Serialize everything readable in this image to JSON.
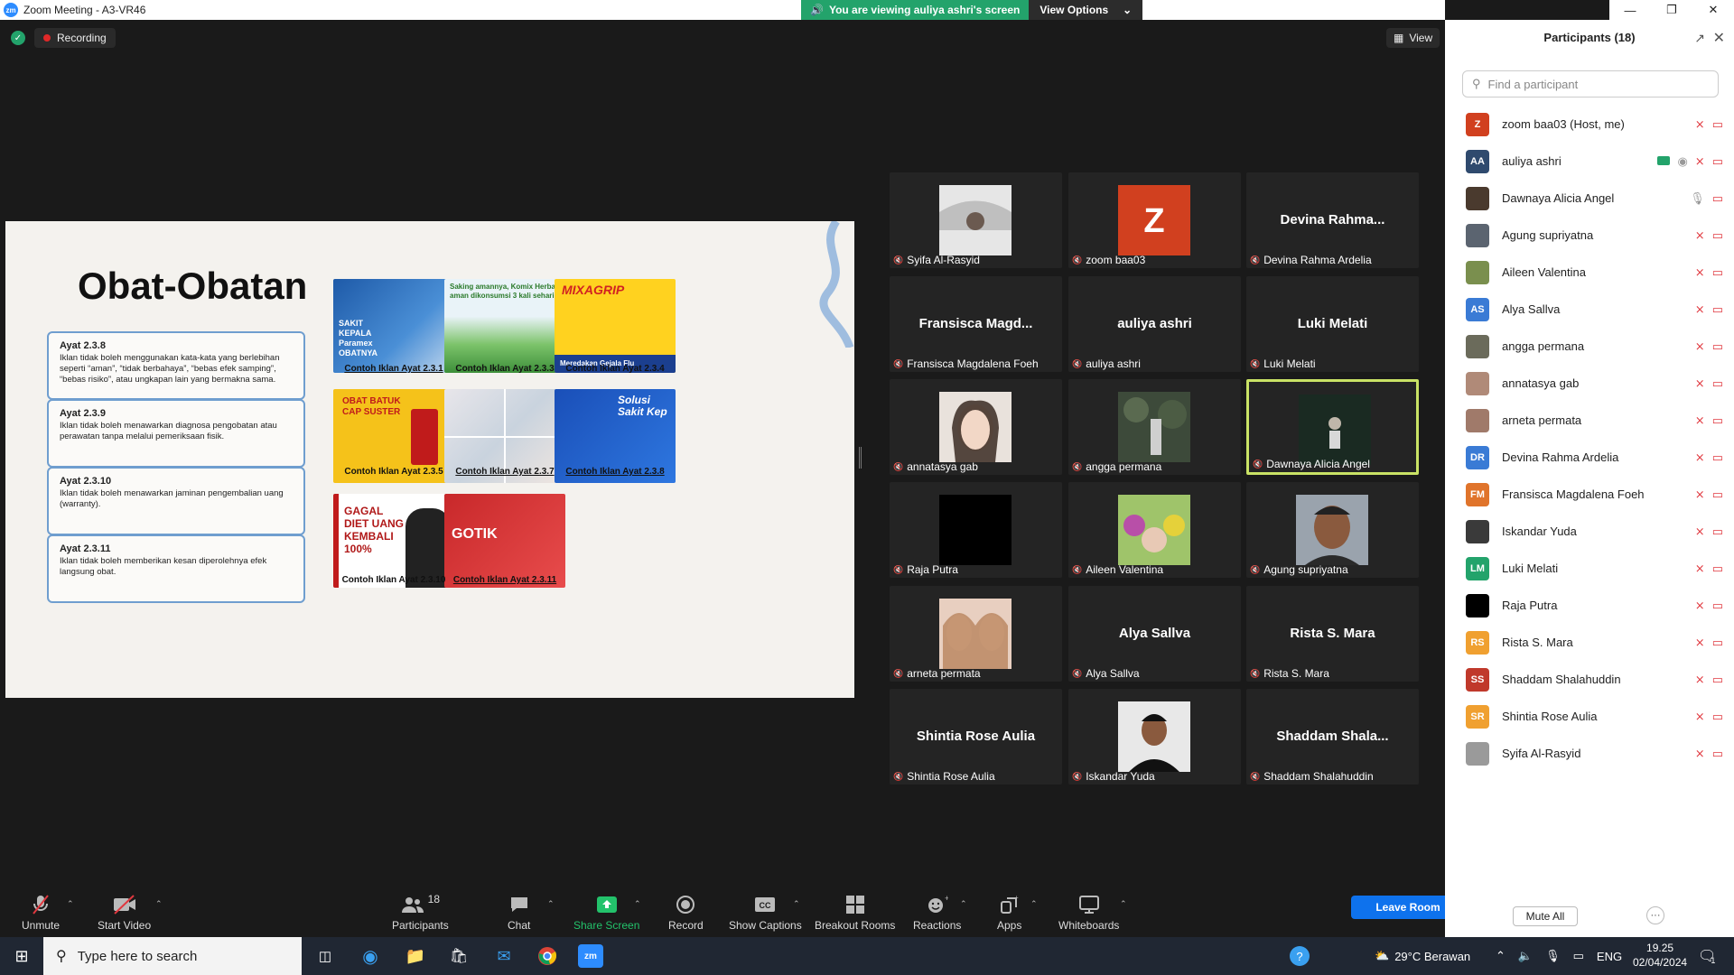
{
  "window": {
    "title": "Zoom Meeting - A3-VR46",
    "app_badge": "zm"
  },
  "banner": {
    "viewing": "You are viewing auliya ashri's screen",
    "view_options": "View Options"
  },
  "top": {
    "recording": "Recording",
    "view": "View"
  },
  "slide": {
    "title": "Obat-Obatan",
    "rules": [
      {
        "head": "Ayat 2.3.8",
        "text": "Iklan tidak boleh menggunakan kata-kata yang berlebihan seperti “aman”, “tidak berbahaya”, “bebas efek samping”, “bebas risiko”, atau ungkapan lain yang bermakna sama."
      },
      {
        "head": "Ayat 2.3.9",
        "text": "Iklan tidak boleh menawarkan diagnosa pengobatan atau perawatan tanpa melalui pemeriksaan fisik."
      },
      {
        "head": "Ayat 2.3.10",
        "text": "Iklan tidak boleh menawarkan jaminan pengembalian uang (warranty)."
      },
      {
        "head": "Ayat 2.3.11",
        "text": "Iklan tidak boleh memberikan kesan diperolehnya efek langsung obat."
      }
    ],
    "captions": [
      "Contoh Iklan Ayat 2.3.1",
      "Contoh Iklan Ayat 2.3.3",
      "Contoh Iklan Ayat 2.3.4",
      "Contoh Iklan Ayat 2.3.5",
      "Contoh Iklan Ayat 2.3.7",
      "Contoh Iklan Ayat 2.3.8",
      "Contoh Iklan Ayat 2.3.10",
      "Contoh Iklan Ayat 2.3.11"
    ],
    "ad_texts": {
      "paramex": "SAKIT KEPALA Paramex OBATNYA",
      "komix": "Saking amannya, Komix Herbal aman dikonsumsi 3 kali sehari!",
      "mixagrip": "MIXAGRIP",
      "mixagrip_sub": "Meredakan Gejala Flu",
      "suster": "OBAT BATUK CAP SUSTER",
      "oskadon": "Solusi Sakit Kep",
      "gagal": "GAGAL DIET UANG KEMBALI 100%",
      "gotik": "GOTIK"
    }
  },
  "gallery": [
    {
      "name": "Syifa Al-Rasyid",
      "big": "",
      "photo": "car",
      "active": false
    },
    {
      "name": "zoom baa03",
      "big": "",
      "photo": "z",
      "active": false
    },
    {
      "name": "Devina Rahma Ardelia",
      "big": "Devina  Rahma...",
      "photo": "",
      "active": false
    },
    {
      "name": "Fransisca Magdalena Foeh",
      "big": "Fransisca  Magd...",
      "photo": "",
      "active": false
    },
    {
      "name": "auliya ashri",
      "big": "auliya ashri",
      "photo": "",
      "active": false
    },
    {
      "name": "Luki Melati",
      "big": "Luki Melati",
      "photo": "",
      "active": false
    },
    {
      "name": "annatasya gab",
      "big": "",
      "photo": "face",
      "active": false
    },
    {
      "name": "angga permana",
      "big": "",
      "photo": "forest",
      "active": false
    },
    {
      "name": "Dawnaya Alicia Angel",
      "big": "",
      "photo": "dark",
      "active": true
    },
    {
      "name": "Raja Putra",
      "big": "",
      "photo": "black",
      "active": false
    },
    {
      "name": "Aileen Valentina",
      "big": "",
      "photo": "tele",
      "active": false
    },
    {
      "name": "Agung supriyatna",
      "big": "",
      "photo": "man",
      "active": false
    },
    {
      "name": "arneta permata",
      "big": "",
      "photo": "twin",
      "active": false
    },
    {
      "name": "Alya Sallva",
      "big": "Alya Sallva",
      "photo": "",
      "active": false
    },
    {
      "name": "Rista S. Mara",
      "big": "Rista S. Mara",
      "photo": "",
      "active": false
    },
    {
      "name": "Shintia Rose Aulia",
      "big": "Shintia Rose Aulia",
      "photo": "",
      "active": false
    },
    {
      "name": "Iskandar Yuda",
      "big": "",
      "photo": "guy",
      "active": false
    },
    {
      "name": "Shaddam Shalahuddin",
      "big": "Shaddam  Shala...",
      "photo": "",
      "active": false
    }
  ],
  "toolbar": {
    "unmute": "Unmute",
    "start_video": "Start Video",
    "participants": "Participants",
    "participants_count": "18",
    "chat": "Chat",
    "share_screen": "Share Screen",
    "record": "Record",
    "captions": "Show Captions",
    "breakout": "Breakout Rooms",
    "reactions": "Reactions",
    "apps": "Apps",
    "whiteboards": "Whiteboards",
    "leave": "Leave Room"
  },
  "panel": {
    "title": "Participants (18)",
    "search_placeholder": "Find a participant",
    "mute_all": "Mute All",
    "more": "···",
    "participants": [
      {
        "name": "zoom baa03 (Host, me)",
        "initials": "Z",
        "color": "#d1401f"
      },
      {
        "name": "auliya ashri",
        "initials": "AA",
        "color": "#2f4a6e"
      },
      {
        "name": "Dawnaya Alicia Angel",
        "initials": "",
        "color": "#4a3a2e"
      },
      {
        "name": "Agung supriyatna",
        "initials": "",
        "color": "#5b6470"
      },
      {
        "name": "Aileen Valentina",
        "initials": "",
        "color": "#7a8f4e"
      },
      {
        "name": "Alya Sallva",
        "initials": "AS",
        "color": "#3a7bd5"
      },
      {
        "name": "angga permana",
        "initials": "",
        "color": "#6b6b5b"
      },
      {
        "name": "annatasya gab",
        "initials": "",
        "color": "#b08a78"
      },
      {
        "name": "arneta permata",
        "initials": "",
        "color": "#a07a6a"
      },
      {
        "name": "Devina Rahma Ardelia",
        "initials": "DR",
        "color": "#3a7bd5"
      },
      {
        "name": "Fransisca Magdalena Foeh",
        "initials": "FM",
        "color": "#e0742b"
      },
      {
        "name": "Iskandar Yuda",
        "initials": "",
        "color": "#3a3a3a"
      },
      {
        "name": "Luki Melati",
        "initials": "LM",
        "color": "#23a36b"
      },
      {
        "name": "Raja Putra",
        "initials": "",
        "color": "#000000"
      },
      {
        "name": "Rista S. Mara",
        "initials": "RS",
        "color": "#f0a030"
      },
      {
        "name": "Shaddam Shalahuddin",
        "initials": "SS",
        "color": "#c0392b"
      },
      {
        "name": "Shintia Rose Aulia",
        "initials": "SR",
        "color": "#f0a030"
      },
      {
        "name": "Syifa Al-Rasyid",
        "initials": "",
        "color": "#9a9a9a"
      }
    ]
  },
  "taskbar": {
    "search_placeholder": "Type here to search",
    "weather": "29°C  Berawan",
    "lang": "ENG",
    "time": "19.25",
    "date": "02/04/2024",
    "notif": "1"
  }
}
